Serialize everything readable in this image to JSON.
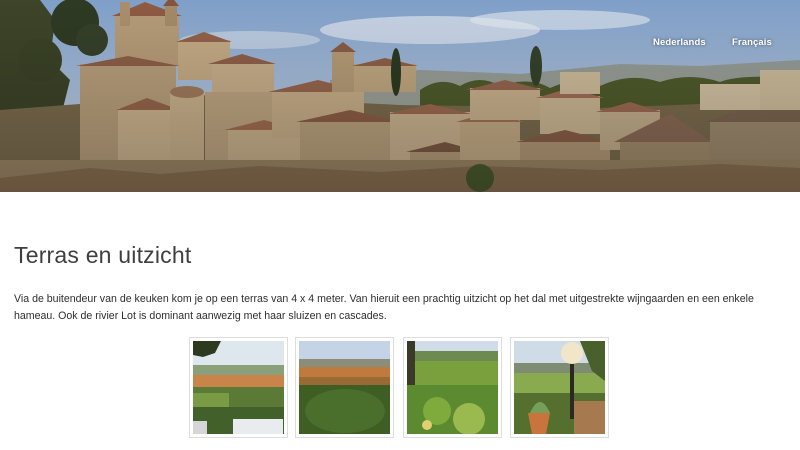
{
  "header": {
    "languages": [
      {
        "label": "Nederlands"
      },
      {
        "label": "Français"
      }
    ]
  },
  "main": {
    "title": "Terras en uitzicht",
    "intro": "Via de buitendeur van de keuken kom je op een terras van 4 x 4 meter. Van hieruit een prachtig uitzicht op het dal met uitgestrekte wijngaarden en een enkele hameau. Ook de rivier Lot is dominant aanwezig met haar sluizen en cascades.",
    "gallery": [
      {
        "subject": "terrace-table-view-photo"
      },
      {
        "subject": "valley-vineyards-photo"
      },
      {
        "subject": "garden-valley-photo"
      },
      {
        "subject": "terrace-lamp-plants-photo"
      }
    ]
  },
  "colors": {
    "sky": "#b9cde6",
    "stone": "#b9a07f",
    "roof": "#9a6a4f",
    "text": "#333333"
  }
}
